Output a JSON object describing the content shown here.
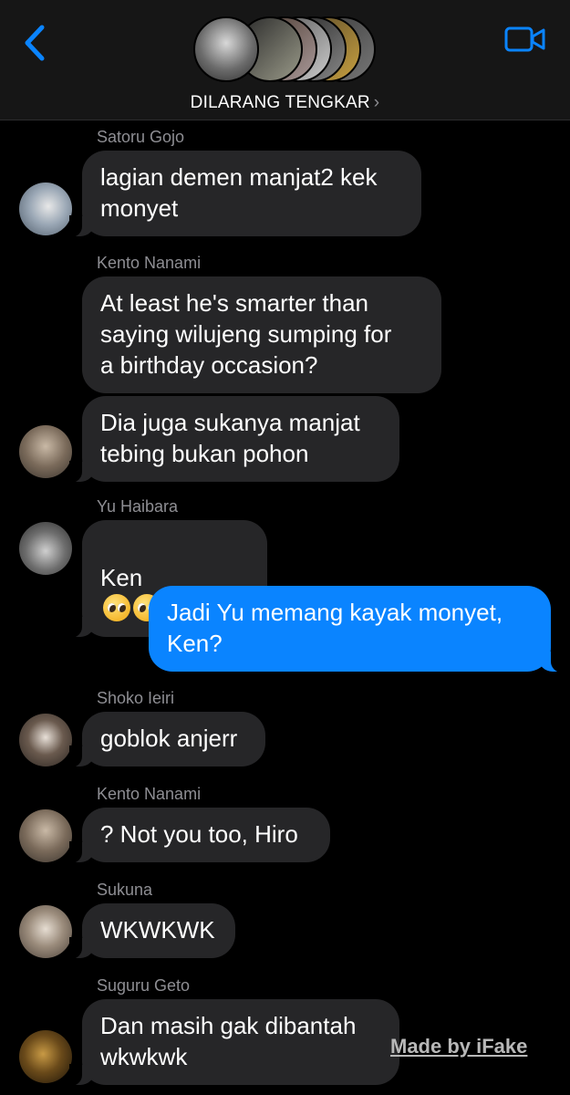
{
  "header": {
    "title": "DILARANG TENGKAR",
    "title_chevron": "›",
    "back_icon": "chevron-left-icon",
    "call_icon": "video-camera-icon",
    "accent": "#0a84ff"
  },
  "messages": [
    {
      "sender": "Satoru Gojo",
      "text": "lagian demen manjat2 kek\nmonyet"
    },
    {
      "sender": "Kento Nanami",
      "text": "At least he's smarter than\nsaying wilujeng sumping for\na birthday occasion?"
    },
    {
      "text": "Dia juga sukanya manjat\ntebing bukan pohon"
    },
    {
      "sender": "Yu Haibara",
      "text": "Ken",
      "emoji": "pleading-face-emoji"
    },
    {
      "text": "Jadi Yu memang kayak monyet,\nKen?",
      "outgoing": true
    },
    {
      "sender": "Shoko Ieiri",
      "text": "goblok anjerr"
    },
    {
      "sender": "Kento Nanami",
      "text": "? Not you too, Hiro"
    },
    {
      "sender": "Sukuna",
      "text": "WKWKWK"
    },
    {
      "sender": "Suguru Geto",
      "text": "Dan masih gak dibantah\nwkwkwk"
    }
  ],
  "watermark": "Made by iFake",
  "colors": {
    "incoming_bubble": "#262628",
    "outgoing_bubble": "#0a84ff",
    "background": "#000000"
  }
}
